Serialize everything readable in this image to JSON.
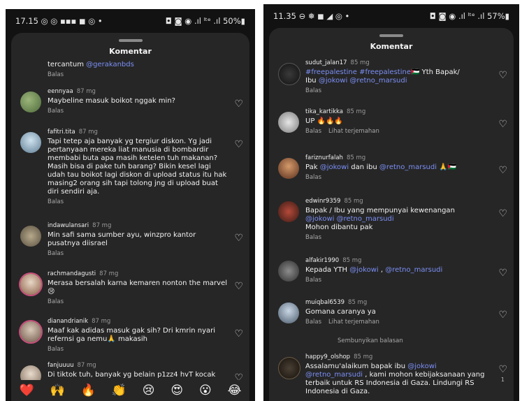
{
  "left_screen": {
    "status": {
      "time": "17.15 ◎ ◎ ▪▪▪ ◼ ◎ •",
      "icons": "◘ ◙ ◉ .ıl ˡᵗᵉ .ıl 50%▮"
    },
    "title": "Komentar",
    "top_partial": {
      "text_before": "tercantum ",
      "mention": "@gerakanbds",
      "reply_label": "Balas"
    },
    "comments": [
      {
        "user": "eennyaa",
        "time": "87 mg",
        "text": "Maybeline masuk boikot nggak min?",
        "reply": "Balas"
      },
      {
        "user": "fafitri.tita",
        "time": "87 mg",
        "text": "Tapi tetep aja banyak yg tergiur diskon. Yg jadi pertanyaan mereka liat manusia di bombardir membabi buta apa masih ketelen tuh makanan? Masih bisa di pake tuh barang? Bikin kesel lagi udah tau boikot lagi diskon di upload status itu hak masing2 orang sih tapi tolong jng di upload buat diri sendiri aja.",
        "reply": "Balas"
      },
      {
        "user": "indawulansari",
        "time": "87 mg",
        "text": "Min safi sama sumber ayu, winzpro kantor pusatnya diisrael",
        "reply": "Balas"
      },
      {
        "user": "rachmandagusti",
        "time": "87 mg",
        "text": "Merasa bersalah karna kemaren nonton the marvel 😢",
        "reply": "Balas"
      },
      {
        "user": "dianandrianik",
        "time": "87 mg",
        "text": "Maaf kak adidas masuk gak sih? Dri kmrin nyari refernsi ga nemu🙏 makasih",
        "reply": "Balas"
      },
      {
        "user": "fanjuuuu",
        "time": "87 mg",
        "text": "Di tiktok tuh, banyak yg belain p1zz4 hvT kocak",
        "reply": ""
      }
    ],
    "emoji_bar": [
      "❤️",
      "🙌",
      "🔥",
      "👏",
      "😢",
      "😍",
      "😮",
      "😂"
    ]
  },
  "right_screen": {
    "status": {
      "time": "11.35 ⊖ ❅ ◼ ◢ ◎ •",
      "icons": "◘ ◙ ◉ .ıl ˡᵗᵉ .ıl 57%▮"
    },
    "title": "Komentar",
    "comments": [
      {
        "user": "sudut_jalan17",
        "time": "85 mg",
        "line1_hashtags": "#freepalestine #freepalestine",
        "line1_after": "🇵🇸 Yth Bapak/",
        "line2_before": "Ibu ",
        "mention1": "@jokowi",
        "mention2": "@retno_marsudi",
        "reply": "Balas"
      },
      {
        "user": "tika_kartikka",
        "time": "85 mg",
        "text": "UP 🔥🔥🔥",
        "reply": "Balas",
        "translate": "Lihat terjemahan"
      },
      {
        "user": "fariznurfalah",
        "time": "85 mg",
        "before": "Pak ",
        "mention1": "@jokowi",
        "middle": " dan ibu ",
        "mention2": "@retno_marsudi",
        "after": " 🙏🇵🇸",
        "reply": "Balas"
      },
      {
        "user": "edwinr9359",
        "time": "85 mg",
        "line1": "Bapak / Ibu yang mempunyai kewenangan",
        "mention1": "@jokowi",
        "mention2": "@retno_marsudi",
        "line3": "Mohon dibantu pak",
        "reply": "Balas"
      },
      {
        "user": "alfakir1990",
        "time": "85 mg",
        "before": "Kepada YTH ",
        "mention1": "@jokowi",
        "middle": " , ",
        "mention2": "@retno_marsudi",
        "reply": "Balas"
      },
      {
        "user": "muiqbal6539",
        "time": "85 mg",
        "text": "Gomana  caranya ya",
        "reply": "Balas",
        "translate": "Lihat terjemahan"
      },
      {
        "user": "happy9_olshop",
        "time": "85 mg",
        "before": "Assalamu'alaikum bapak ibu ",
        "mention1": "@jokowi",
        "mention2": "@retno_marsudi",
        "after": " , kami mohon kebijaksanaan yang terbaik untuk RS Indonesia di Gaza. Lindungi RS Indonesia di Gaza.",
        "likes": "1"
      }
    ],
    "hide_replies": "Sembunyikan balasan"
  }
}
